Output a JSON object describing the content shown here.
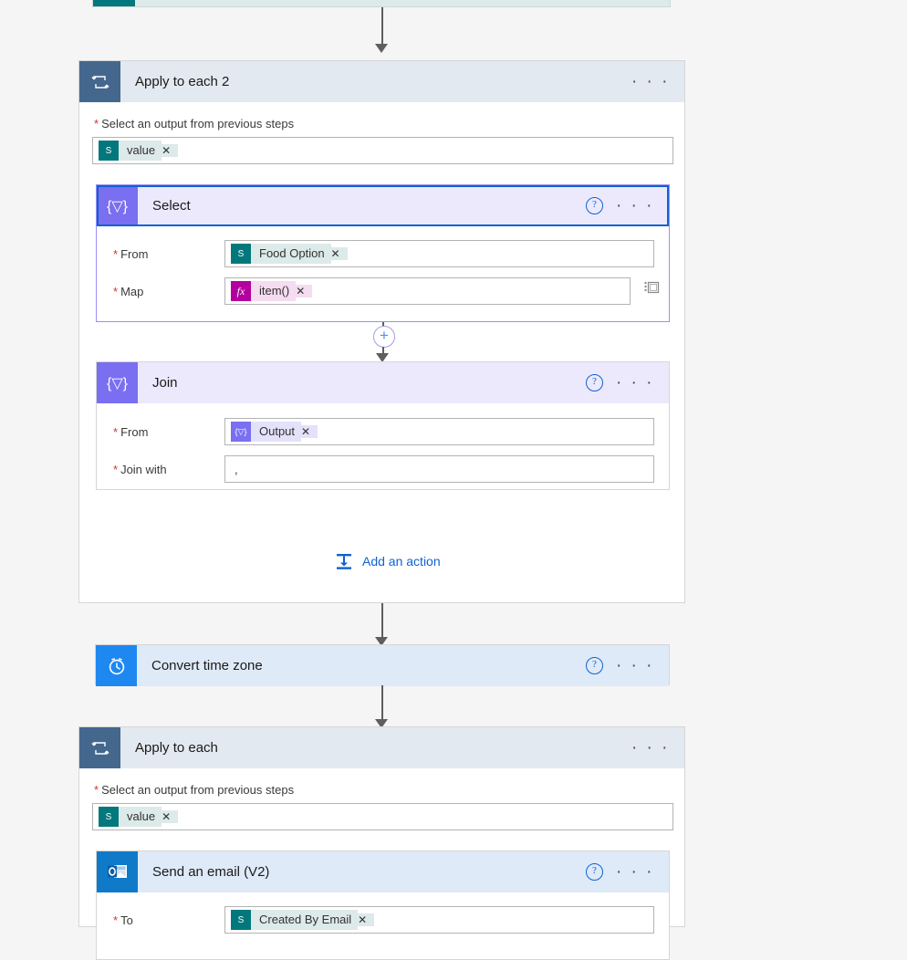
{
  "app": {
    "name": "Power Automate flow designer",
    "canvas_background": "#f5f5f5"
  },
  "colors": {
    "loop_tile": "#44678e",
    "loop_header": "#e3e9f0",
    "select_tile": "#7a6ff0",
    "select_header": "#ece9fd",
    "clock_tile": "#1e88f0",
    "blue_header": "#deeaf8",
    "mail_tile": "#0f7ac8",
    "sharepoint_token": "#03787c",
    "expression_token": "#b4009e",
    "link_blue": "#0f62d0",
    "required_red": "#d13438",
    "selected_border": "#0f62d0"
  },
  "partial_top_card": {
    "name": "truncated-sharepoint-action",
    "icon": "sharepoint-icon"
  },
  "apply_to_each_2": {
    "title": "Apply to each 2",
    "icon": "loop-icon",
    "more_label": "· · ·",
    "input_label": "Select an output from previous steps",
    "required_marker": "*",
    "token": {
      "icon": "sharepoint-icon",
      "icon_glyph": "S",
      "text": "value",
      "remove": "✕"
    }
  },
  "select_action": {
    "title": "Select",
    "icon": "select-data-operation-icon",
    "icon_glyph": "{▽}",
    "help_label": "?",
    "more_label": "· · ·",
    "selected": true,
    "fields": [
      {
        "label": "From",
        "required": "*",
        "token": {
          "kind": "sharepoint",
          "icon": "sharepoint-icon",
          "icon_glyph": "S",
          "text": "Food Option",
          "remove": "✕"
        }
      },
      {
        "label": "Map",
        "required": "*",
        "token": {
          "kind": "expression",
          "icon": "function-fx-icon",
          "icon_glyph": "fx",
          "text": "item()",
          "remove": "✕"
        },
        "trailing_icon": "switch-to-text-mode-icon"
      }
    ]
  },
  "connector_plus": {
    "label": "+",
    "name": "insert-new-step-button"
  },
  "join_action": {
    "title": "Join",
    "icon": "join-data-operation-icon",
    "icon_glyph": "{▽}",
    "help_label": "?",
    "more_label": "· · ·",
    "fields": [
      {
        "label": "From",
        "required": "*",
        "token": {
          "kind": "select-output",
          "icon": "select-data-operation-icon",
          "icon_glyph": "{▽}",
          "text": "Output",
          "remove": "✕"
        }
      },
      {
        "label": "Join with",
        "required": "*",
        "value": ","
      }
    ]
  },
  "add_an_action": {
    "label": "Add an action",
    "icon": "add-action-icon"
  },
  "convert_time_zone": {
    "title": "Convert time zone",
    "icon": "clock-icon",
    "help_label": "?",
    "more_label": "· · ·"
  },
  "apply_to_each": {
    "title": "Apply to each",
    "icon": "loop-icon",
    "more_label": "· · ·",
    "input_label": "Select an output from previous steps",
    "required_marker": "*",
    "token": {
      "icon": "sharepoint-icon",
      "icon_glyph": "S",
      "text": "value",
      "remove": "✕"
    }
  },
  "send_an_email": {
    "title": "Send an email (V2)",
    "icon": "outlook-icon",
    "help_label": "?",
    "more_label": "· · ·",
    "fields": [
      {
        "label": "To",
        "required": "*",
        "token": {
          "kind": "sharepoint",
          "icon": "sharepoint-icon",
          "icon_glyph": "S",
          "text": "Created By Email",
          "remove": "✕"
        }
      }
    ]
  }
}
